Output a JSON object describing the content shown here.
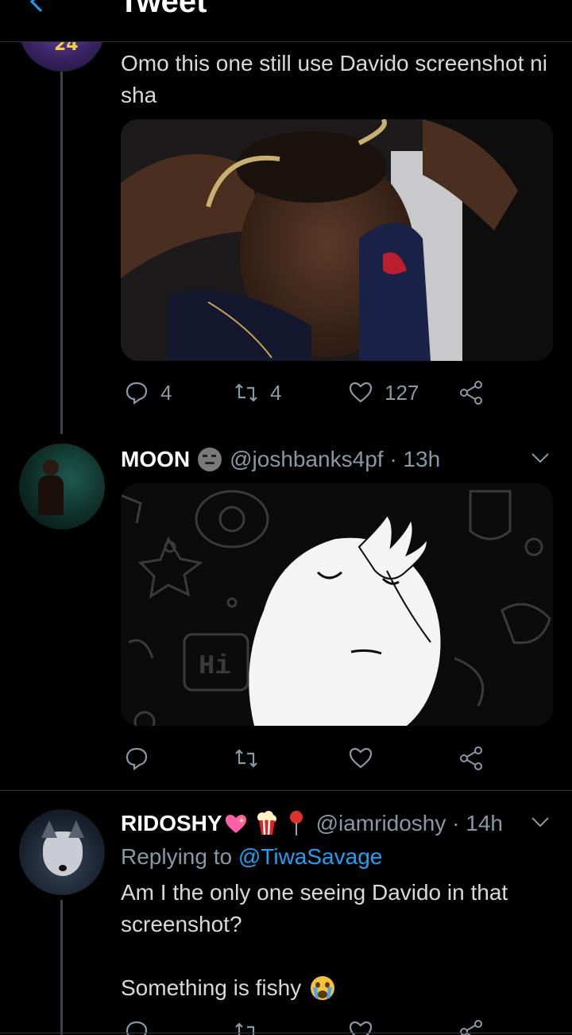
{
  "header": {
    "title": "Tweet"
  },
  "tweet1": {
    "avatar_jersey": "24",
    "text": "Omo this one still use Davido screenshot ni sha",
    "actions": {
      "replies": "4",
      "retweets": "4",
      "likes": "127"
    }
  },
  "tweet2": {
    "display_name": "MOON",
    "handle_time": "@joshbanks4pf · 13h",
    "media_badge_text": "Hi"
  },
  "tweet3": {
    "display_name": "RIDOSHY",
    "handle_time": "@iamridoshy · 14h",
    "replying_prefix": "Replying to ",
    "replying_handle": "@TiwaSavage",
    "text_line1": "Am I the only one seeing Davido in that",
    "text_line2": "screenshot?",
    "text_line3": "Something is fishy"
  },
  "colors": {
    "accent": "#1da1f2",
    "muted": "#8899a6",
    "background": "#000000"
  }
}
